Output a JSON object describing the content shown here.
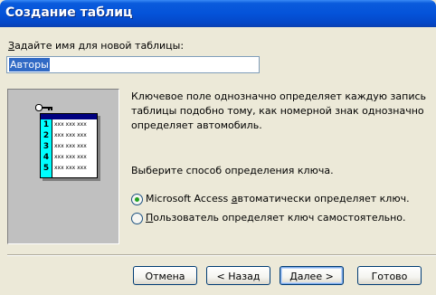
{
  "window": {
    "title": "Создание таблиц"
  },
  "name_prompt": {
    "label_hotkey": "З",
    "label_rest": "адайте имя для новой таблицы:",
    "value": "Авторы"
  },
  "preview": {
    "key_icon": "key-icon",
    "rows": [
      {
        "num": "1",
        "cells": "xxx xxx xxx"
      },
      {
        "num": "2",
        "cells": "xxx xxx xxx"
      },
      {
        "num": "3",
        "cells": "xxx xxx xxx"
      },
      {
        "num": "4",
        "cells": "xxx xxx xxx"
      },
      {
        "num": "5",
        "cells": "xxx xxx xxx"
      }
    ]
  },
  "description": "Ключевое поле однозначно определяет каждую запись таблицы подобно тому, как номерной знак однозначно определяет автомобиль.",
  "choose_label": "Выберите способ определения ключа.",
  "options": [
    {
      "label_pre": "Microsoft Access ",
      "label_hotkey": "а",
      "label_post": "втоматически определяет ключ.",
      "selected": true
    },
    {
      "label_pre": "",
      "label_hotkey": "П",
      "label_post": "ользователь определяет ключ самостоятельно.",
      "selected": false
    }
  ],
  "buttons": {
    "cancel": "Отмена",
    "back": "< Назад",
    "next": "Далее >",
    "finish": "Готово"
  },
  "colors": {
    "titlebar": "#0453d9",
    "accent_selection": "#316ac5",
    "radio_dot": "#21a121"
  }
}
